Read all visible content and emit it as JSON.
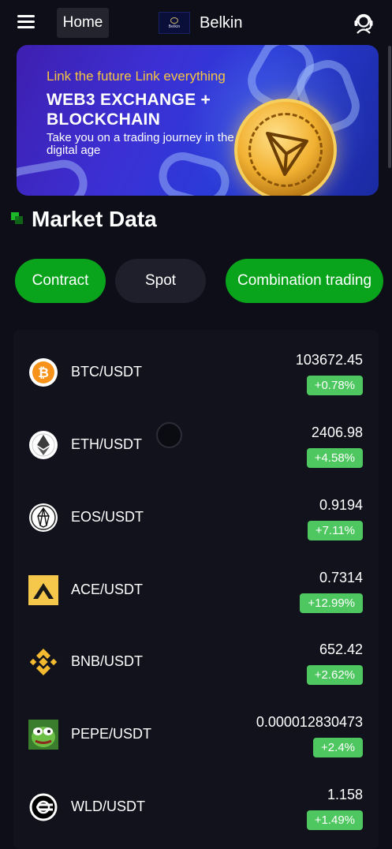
{
  "header": {
    "home_label": "Home",
    "brand_logo_text": "Belkin",
    "brand_name": "Belkin"
  },
  "banner": {
    "line1": "Link the future  Link everything",
    "line2": "WEB3 EXCHANGE +",
    "line3": "BLOCKCHAIN",
    "line4": "Take you on a trading journey in the digital age"
  },
  "section": {
    "title": "Market Data"
  },
  "tabs": [
    {
      "label": "Contract",
      "active": true
    },
    {
      "label": "Spot",
      "active": false
    },
    {
      "label": "Combination trading",
      "active": true
    }
  ],
  "markets": [
    {
      "pair": "BTC/USDT",
      "price": "103672.45",
      "change": "+0.78%",
      "icon": "bitcoin-icon"
    },
    {
      "pair": "ETH/USDT",
      "price": "2406.98",
      "change": "+4.58%",
      "icon": "ethereum-icon"
    },
    {
      "pair": "EOS/USDT",
      "price": "0.9194",
      "change": "+7.11%",
      "icon": "eos-icon"
    },
    {
      "pair": "ACE/USDT",
      "price": "0.7314",
      "change": "+12.99%",
      "icon": "ace-icon"
    },
    {
      "pair": "BNB/USDT",
      "price": "652.42",
      "change": "+2.62%",
      "icon": "bnb-icon"
    },
    {
      "pair": "PEPE/USDT",
      "price": "0.000012830473",
      "change": "+2.4%",
      "icon": "pepe-icon"
    },
    {
      "pair": "WLD/USDT",
      "price": "1.158",
      "change": "+1.49%",
      "icon": "worldcoin-icon"
    }
  ],
  "colors": {
    "background": "#0d0e18",
    "accent_green": "#0aa41c",
    "change_green": "#4fc760"
  }
}
